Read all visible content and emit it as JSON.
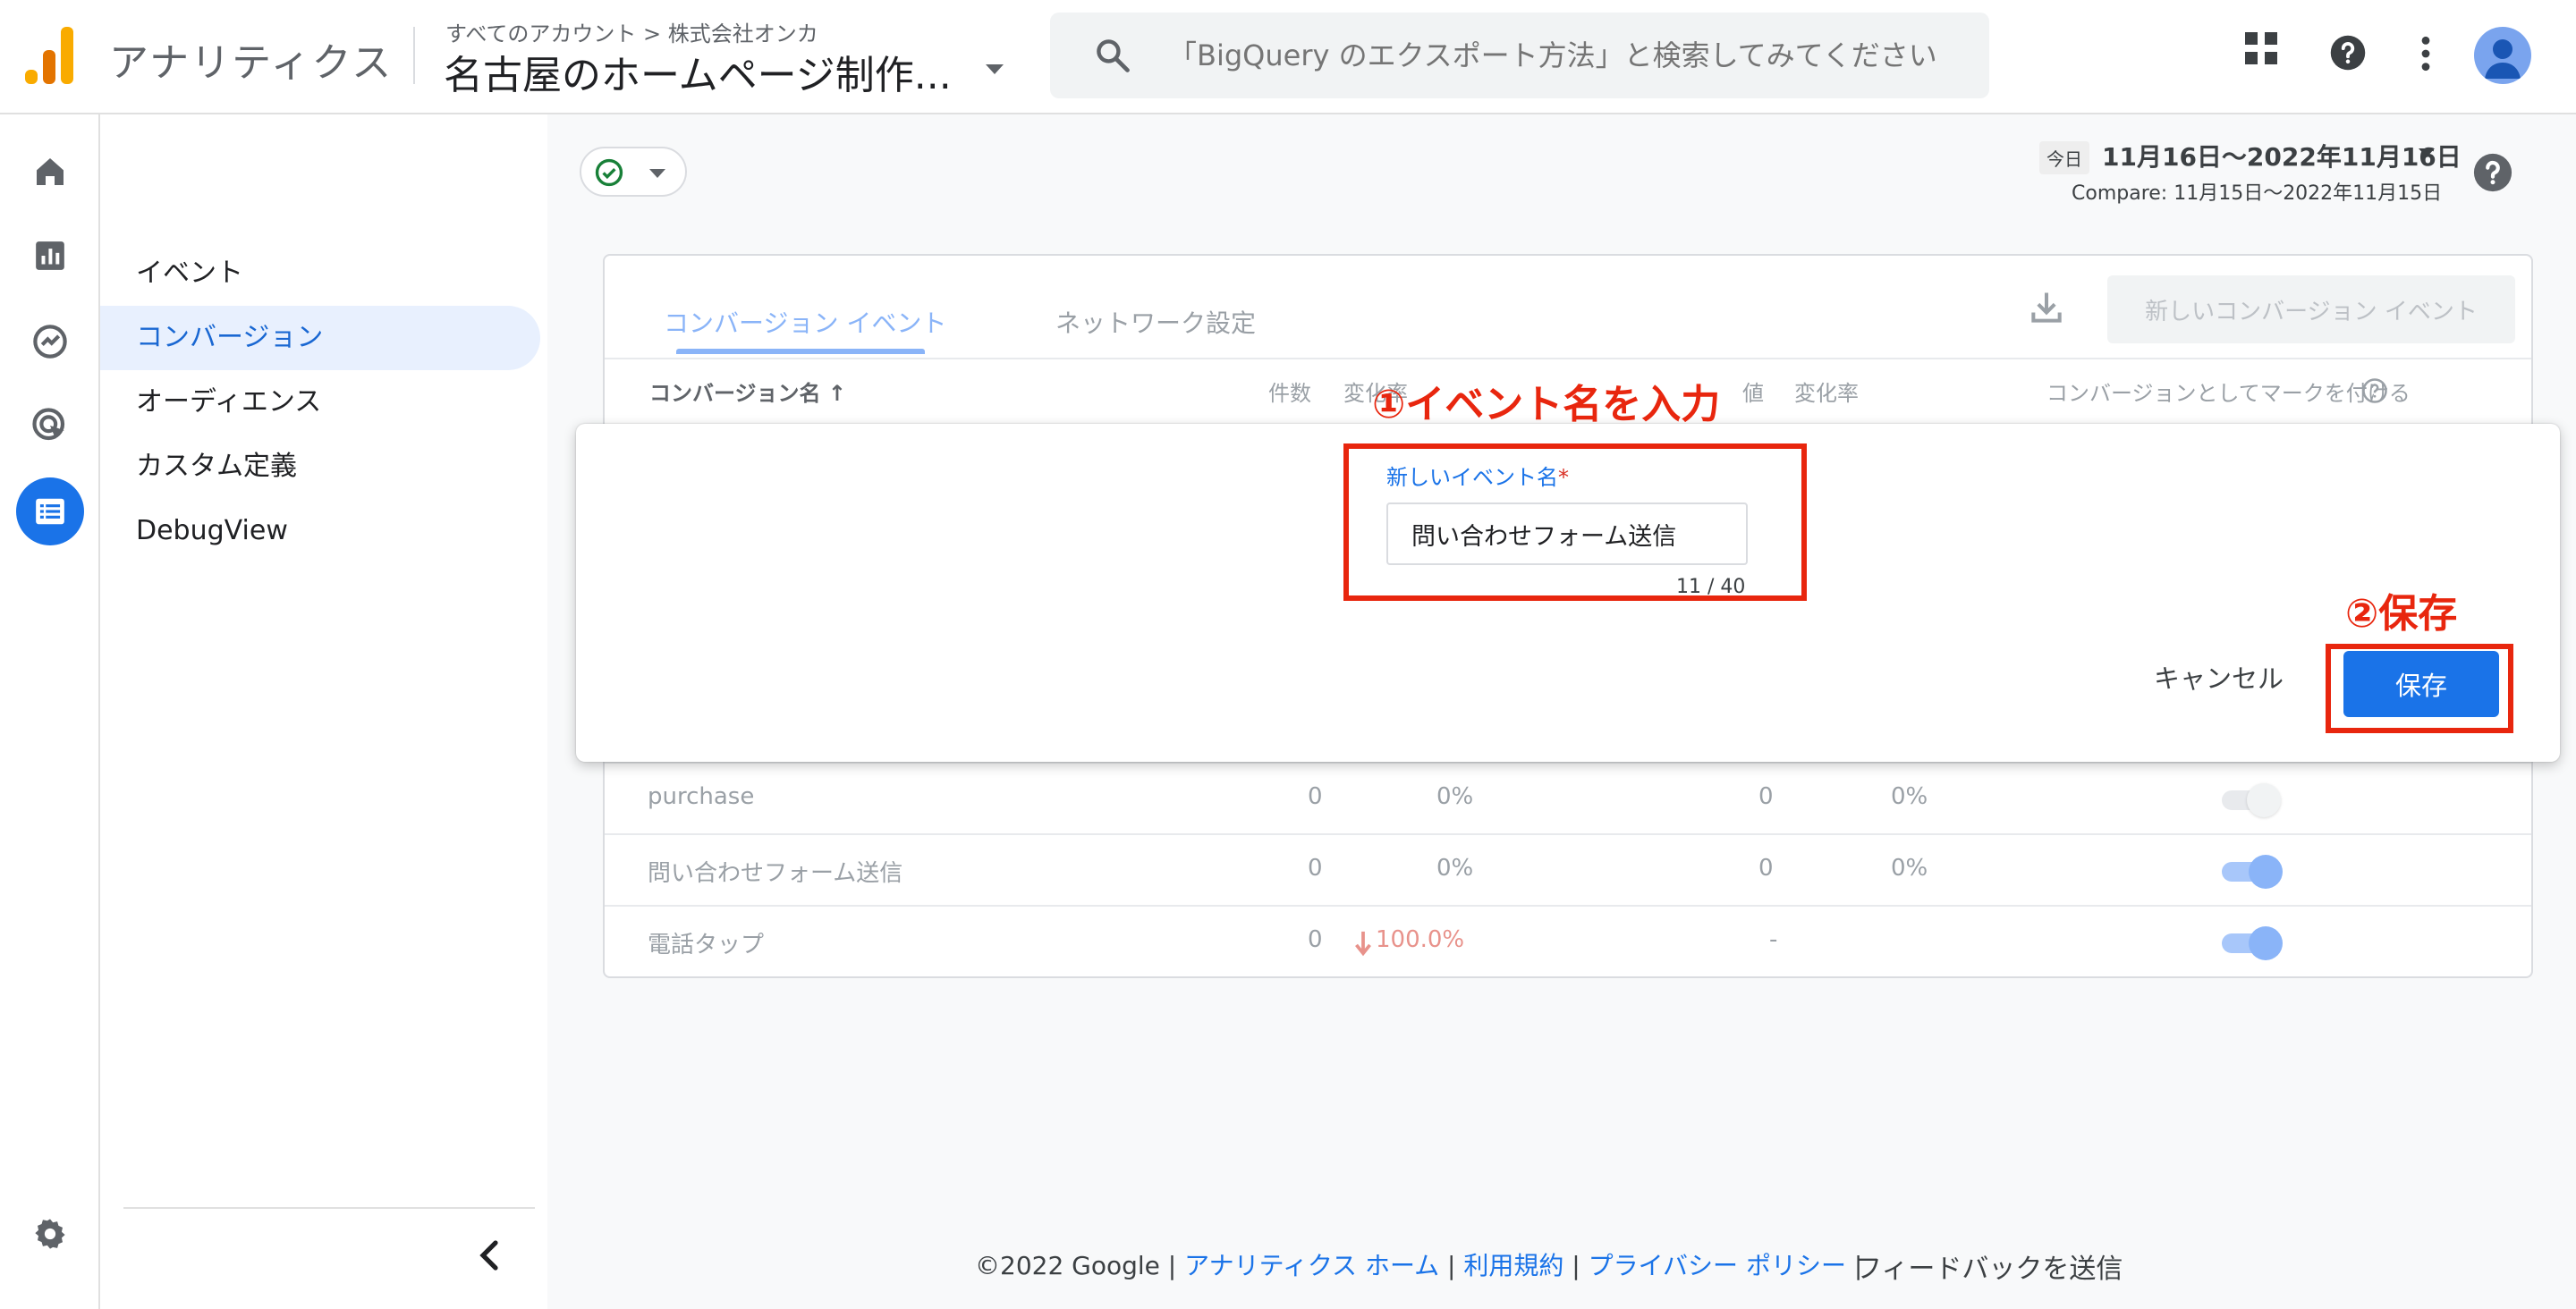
{
  "header": {
    "app_title": "アナリティクス",
    "breadcrumb": "すべてのアカウント > 株式会社オンカ",
    "property": "名古屋のホームページ制作...",
    "search_placeholder": "「BigQuery のエクスポート方法」と検索してみてください"
  },
  "subnav": {
    "items": [
      "イベント",
      "コンバージョン",
      "オーディエンス",
      "カスタム定義",
      "DebugView"
    ]
  },
  "date": {
    "today_label": "今日",
    "range": "11月16日〜2022年11月16日",
    "compare": "Compare: 11月15日〜2022年11月15日"
  },
  "card": {
    "tabs": [
      "コンバージョン イベント",
      "ネットワーク設定"
    ],
    "new_button": "新しいコンバージョン イベント",
    "columns": {
      "name": "コンバージョン名 ↑",
      "count": "件数",
      "change": "変化率",
      "value": "値",
      "value_change": "変化率",
      "mark": "コンバージョンとしてマークを付ける"
    },
    "rows": [
      {
        "name": "purchase",
        "count": "0",
        "change": "0%",
        "value": "0",
        "value_change": "0%",
        "toggle_on": false
      },
      {
        "name": "問い合わせフォーム送信",
        "count": "0",
        "change": "0%",
        "value": "0",
        "value_change": "0%",
        "toggle_on": true
      },
      {
        "name": "電話タップ",
        "count": "0",
        "change": "100.0%",
        "value": "-",
        "value_change": "",
        "toggle_on": true
      }
    ]
  },
  "dialog": {
    "field_label": "新しいイベント名",
    "required_mark": "*",
    "field_value": "問い合わせフォーム送信",
    "counter": "11 / 40",
    "cancel": "キャンセル",
    "save": "保存"
  },
  "annotations": {
    "step1": "①イベント名を入力",
    "step2": "②保存",
    "color": "#e8260e"
  },
  "footer": {
    "copyright": "©2022 Google",
    "links": [
      "アナリティクス ホーム",
      "利用規約",
      "プライバシー ポリシー"
    ],
    "feedback": "フィードバックを送信"
  },
  "colors": {
    "accent": "#1a73e8",
    "toggle_on": "#8ab4f8"
  }
}
